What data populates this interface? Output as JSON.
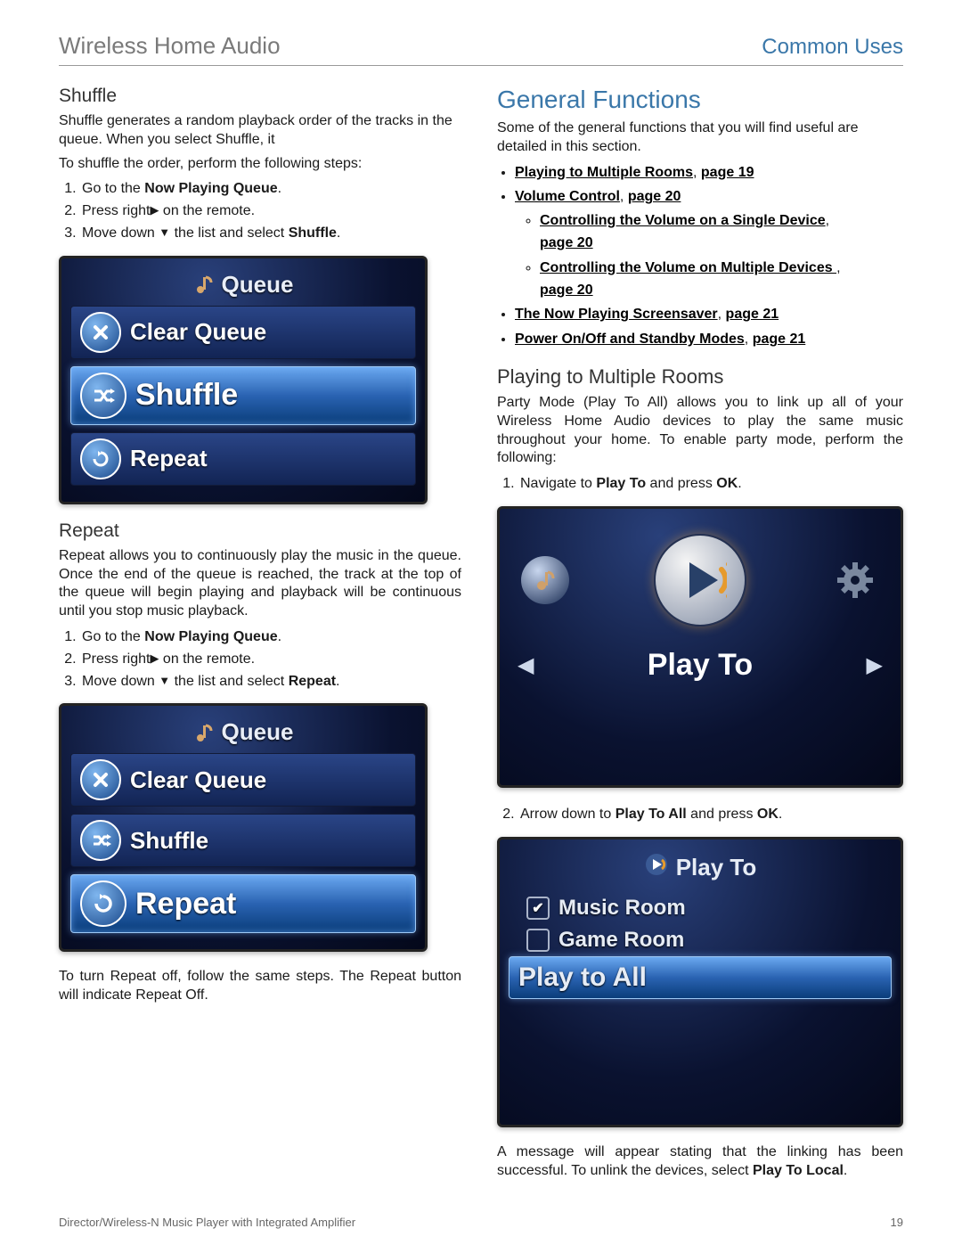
{
  "header": {
    "left": "Wireless Home Audio",
    "right": "Common Uses"
  },
  "left_col": {
    "shuffle": {
      "heading": "Shuffle",
      "intro": "Shuffle generates a random playback order of the tracks in the queue. When you select Shuffle, it",
      "lead": "To shuffle the order, perform the following steps:",
      "step1_a": "Go to the ",
      "step1_b": "Now Playing Queue",
      "step1_c": ".",
      "step2_a": "Press right",
      "step2_b": "on the remote.",
      "step3_a": "Move down",
      "step3_b": "the list and select ",
      "step3_c": "Shuffle",
      "step3_d": "."
    },
    "queue1": {
      "title": "Queue",
      "items": [
        {
          "label": "Clear Queue",
          "selected": false,
          "icon": "x"
        },
        {
          "label": "Shuffle",
          "selected": true,
          "icon": "shuffle"
        },
        {
          "label": "Repeat",
          "selected": false,
          "icon": "repeat"
        }
      ]
    },
    "repeat": {
      "heading": "Repeat",
      "intro": "Repeat allows you to continuously play the music in the queue. Once the end of the queue is reached, the track at the top of the queue will begin playing and playback will be continuous until you stop music playback.",
      "step1_a": "Go to the ",
      "step1_b": "Now Playing Queue",
      "step1_c": ".",
      "step2_a": "Press right",
      "step2_b": "on the remote.",
      "step3_a": "Move down",
      "step3_b": "the list and select ",
      "step3_c": "Repeat",
      "step3_d": "."
    },
    "queue2": {
      "title": "Queue",
      "items": [
        {
          "label": "Clear Queue",
          "selected": false,
          "icon": "x"
        },
        {
          "label": "Shuffle",
          "selected": false,
          "icon": "shuffle"
        },
        {
          "label": "Repeat",
          "selected": true,
          "icon": "repeat"
        }
      ]
    },
    "repeat_off": "To turn Repeat off, follow the same steps. The Repeat button will indicate Repeat Off."
  },
  "right_col": {
    "general": {
      "heading": "General Functions",
      "intro": "Some of the general functions that you will find useful are detailed in this section.",
      "toc": {
        "i1_a": "Playing to Multiple Rooms",
        "i1_b": ", ",
        "i1_c": "page 19",
        "i2_a": "Volume Control",
        "i2_b": ", ",
        "i2_c": "page 20",
        "i2s1_a": "Controlling the Volume on a Single Device",
        "i2s1_b": ", ",
        "i2s1_c": "page 20",
        "i2s2_a": "Controlling the Volume on Multiple Devices ",
        "i2s2_b": ", ",
        "i2s2_c": "page 20",
        "i3_a": "The Now Playing Screensaver",
        "i3_b": ", ",
        "i3_c": "page 21",
        "i4_a": "Power On/Off and Standby Modes",
        "i4_b": ", ",
        "i4_c": "page 21"
      }
    },
    "ptmr": {
      "heading": "Playing to Multiple Rooms",
      "intro": "Party Mode (Play To All) allows you to link up all of your Wireless Home Audio devices to play the same music throughout your home. To enable party mode, perform the following:",
      "step1_a": "Navigate to ",
      "step1_b": "Play To",
      "step1_c": " and press ",
      "step1_d": "OK",
      "step1_e": ".",
      "play_to_label": "Play To",
      "step2_a": "Arrow down to ",
      "step2_b": "Play To All",
      "step2_c": " and press ",
      "step2_d": "OK",
      "step2_e": "."
    },
    "ptolist": {
      "title": "Play To",
      "rows": [
        {
          "label": "Music Room",
          "checked": true,
          "selected": false
        },
        {
          "label": "Game Room",
          "checked": false,
          "selected": false
        },
        {
          "label": "Play to All",
          "checked": null,
          "selected": true
        }
      ]
    },
    "closing_a": "A message will appear stating that the linking has been successful. To unlink the devices, select ",
    "closing_b": "Play To Local",
    "closing_c": "."
  },
  "footer": {
    "left": "Director/Wireless-N Music Player with Integrated Amplifier",
    "right": "19"
  },
  "glyphs": {
    "right": "▶",
    "down": "▼",
    "left": "◀",
    "check": "✔"
  }
}
